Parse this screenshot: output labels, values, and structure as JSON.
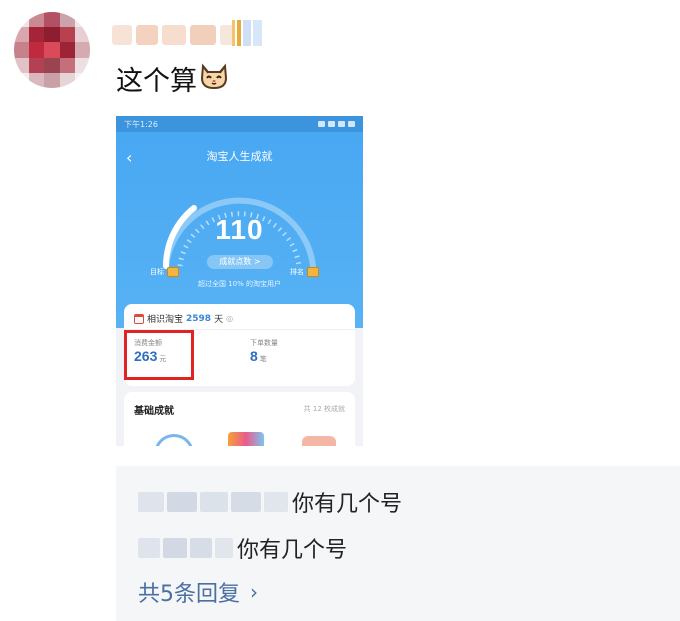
{
  "post": {
    "text": "这个算",
    "emoji_icon": "cat-face-icon"
  },
  "embedded_app": {
    "title": "淘宝人生成就",
    "back_icon": "chevron-left-icon",
    "status_time": "下午1:26",
    "score": "110",
    "points_button": "成就点数 >",
    "left_label": "目标",
    "right_label": "排名",
    "beat_text": "超过全国 10% 的淘宝用户",
    "since_prefix": "相识淘宝",
    "since_days": "2598",
    "since_suffix": "天",
    "spend_label": "消费金额",
    "spend_value": "263",
    "spend_unit": "元",
    "orders_label": "下单数量",
    "orders_value": "8",
    "orders_unit": "笔",
    "achievements_title": "基础成就",
    "achievements_count": "共 12 枚成就",
    "colors": {
      "header_blue": "#4aa9f2",
      "value_blue": "#2c6fc4",
      "highlight_red": "#e02424"
    }
  },
  "comments": {
    "replies": [
      {
        "text": "你有几个号"
      },
      {
        "text": "你有几个号"
      }
    ],
    "more_label": "共5条回复",
    "more_icon": "chevron-right-icon"
  }
}
